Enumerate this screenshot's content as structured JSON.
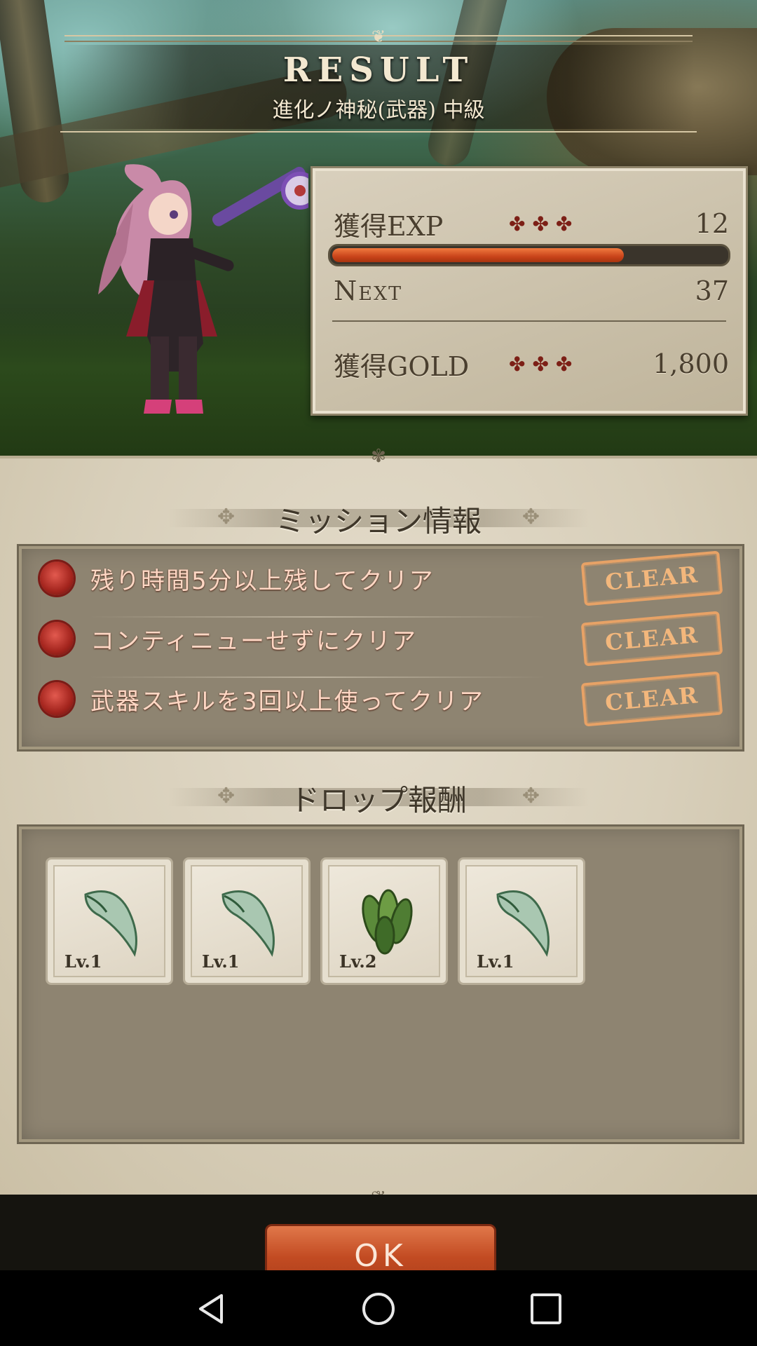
{
  "header": {
    "title": "RESULT",
    "stage": "進化ノ神秘(武器) 中級"
  },
  "stats": {
    "exp_label": "獲得EXP",
    "exp_value": "12",
    "exp_progress": 0.74,
    "next_label": "Next",
    "next_value": "37",
    "gold_label": "獲得GOLD",
    "gold_value": "1,800",
    "decor": "✤✤✤"
  },
  "missions": {
    "title": "ミッション情報",
    "items": [
      {
        "text": "残り時間5分以上残してクリア",
        "status": "CLEAR"
      },
      {
        "text": "コンティニューせずにクリア",
        "status": "CLEAR"
      },
      {
        "text": "武器スキルを3回以上使ってクリア",
        "status": "CLEAR"
      }
    ]
  },
  "drops": {
    "title": "ドロップ報酬",
    "items": [
      {
        "icon": "claw-icon",
        "level": "Lv.1"
      },
      {
        "icon": "claw-icon",
        "level": "Lv.1"
      },
      {
        "icon": "leaf-cluster-icon",
        "level": "Lv.2"
      },
      {
        "icon": "claw-icon",
        "level": "Lv.1"
      }
    ]
  },
  "ok_button": "OK",
  "colors": {
    "accent": "#c24b22",
    "clear_stamp": "#e7a266",
    "mission_text": "#ffd7c4"
  }
}
